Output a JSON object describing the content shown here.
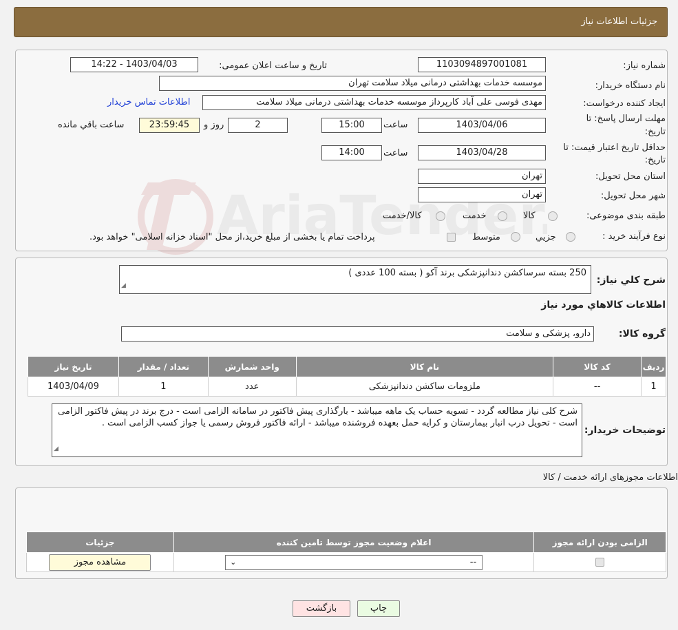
{
  "header": {
    "title": "جزئیات اطلاعات نیاز"
  },
  "info": {
    "need_number_label": "شماره نیاز:",
    "need_number": "1103094897001081",
    "announce_label": "تاریخ و ساعت اعلان عمومی:",
    "announce_value": "1403/04/03 - 14:22",
    "buyer_label": "نام دستگاه خریدار:",
    "buyer_value": "موسسه خدمات بهداشتی درمانی میلاد سلامت تهران",
    "creator_label": "ایجاد کننده درخواست:",
    "creator_value": "مهدی فوسی علی آباد کارپرداز موسسه خدمات بهداشتی درمانی میلاد سلامت",
    "contact_link": "اطلاعات تماس خریدار",
    "deadline_label_1": "مهلت ارسال پاسخ: تا",
    "deadline_label_2": "تاریخ:",
    "deadline_date": "1403/04/06",
    "hour_label": "ساعت",
    "deadline_time": "15:00",
    "days_value": "2",
    "days_label": "روز و",
    "remaining_time": "23:59:45",
    "remaining_label": "ساعت باقي مانده",
    "validity_label_1": "حداقل تاریخ اعتبار قیمت: تا",
    "validity_label_2": "تاریخ:",
    "validity_date": "1403/04/28",
    "validity_time": "14:00",
    "province_label": "استان محل تحویل:",
    "province_value": "تهران",
    "city_label": "شهر محل تحویل:",
    "city_value": "تهران",
    "category_label": "طبقه بندی موضوعی:",
    "category_options": [
      "کالا",
      "خدمت",
      "کالا/خدمت"
    ],
    "process_label": "نوع فرآیند خرید :",
    "process_options": [
      "جزيي",
      "متوسط"
    ],
    "process_note": "پرداخت تمام یا بخشی از مبلغ خرید،از محل \"اسناد خزانه اسلامی\" خواهد بود."
  },
  "summary": {
    "label": "شرح كلي نياز:",
    "value": "250 بسته سرساکشن دندانپزشکی برند آکو  ( بسته 100 عددی )",
    "goods_title": "اطلاعات كالاهاي مورد نياز",
    "group_label": "گروه كالا:",
    "group_value": "دارو، پزشکی و سلامت"
  },
  "goods_table": {
    "headers": [
      "رديف",
      "كد كالا",
      "نام كالا",
      "واحد شمارش",
      "تعداد / مقدار",
      "تاريخ نياز"
    ],
    "rows": [
      [
        "1",
        "--",
        "ملزومات ساکشن دندانپزشکی",
        "عدد",
        "1",
        "1403/04/09"
      ]
    ]
  },
  "buyer_notes": {
    "label": "توضیحات خریدار:",
    "value": "شرح کلی نیاز مطالعه گردد - تسویه حساب یک ماهه میباشد - بارگذاری پیش فاکتور در سامانه الزامی است - درج برند در پیش فاکتور الزامی است - تحویل درب انبار بیمارستان و کرایه حمل بعهده فروشنده میباشد - ارائه فاکتور فروش رسمی یا جواز کسب الزامی است ."
  },
  "permits": {
    "title": "اطلاعات مجوزهای ارائه خدمت / کالا",
    "headers": [
      "الزامی بودن ارائه مجوز",
      "اعلام وضعیت مجوز توسط تامین کننده",
      "جزئیات"
    ],
    "select_value": "--",
    "view_button": "مشاهده مجوز"
  },
  "buttons": {
    "print": "چاپ",
    "back": "بازگشت"
  },
  "watermark": {
    "text": "AriaTender.neT"
  },
  "colors": {
    "header_bg": "#8b6d3f",
    "table_header": "#8c8c8c",
    "link": "#1f3fd6"
  }
}
